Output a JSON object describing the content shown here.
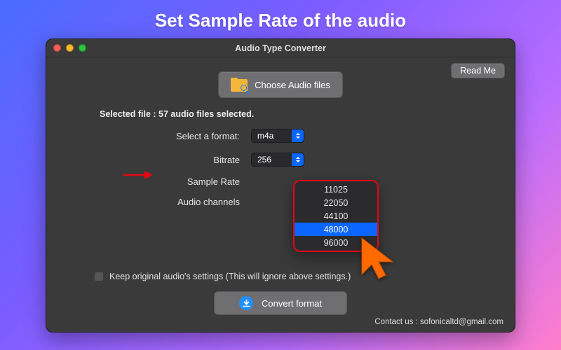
{
  "banner": "Set Sample Rate of the audio",
  "window": {
    "title": "Audio Type Converter"
  },
  "buttons": {
    "readme": "Read Me",
    "choose": "Choose Audio files",
    "convert": "Convert format"
  },
  "status": {
    "text": "Selected file : 57 audio files selected."
  },
  "form": {
    "format": {
      "label": "Select a format:",
      "value": "m4a"
    },
    "bitrate": {
      "label": "Bitrate",
      "value": "256"
    },
    "sample_rate": {
      "label": "Sample Rate"
    },
    "channels": {
      "label": "Audio channels"
    }
  },
  "keep_original": {
    "label": "Keep original audio's settings (This will ignore above settings.)"
  },
  "sample_rate_options": {
    "o0": "11025",
    "o1": "22050",
    "o2": "44100",
    "o3": "48000",
    "o4": "96000"
  },
  "contact": {
    "text": "Contact us : sofonicaltd@gmail.com"
  }
}
